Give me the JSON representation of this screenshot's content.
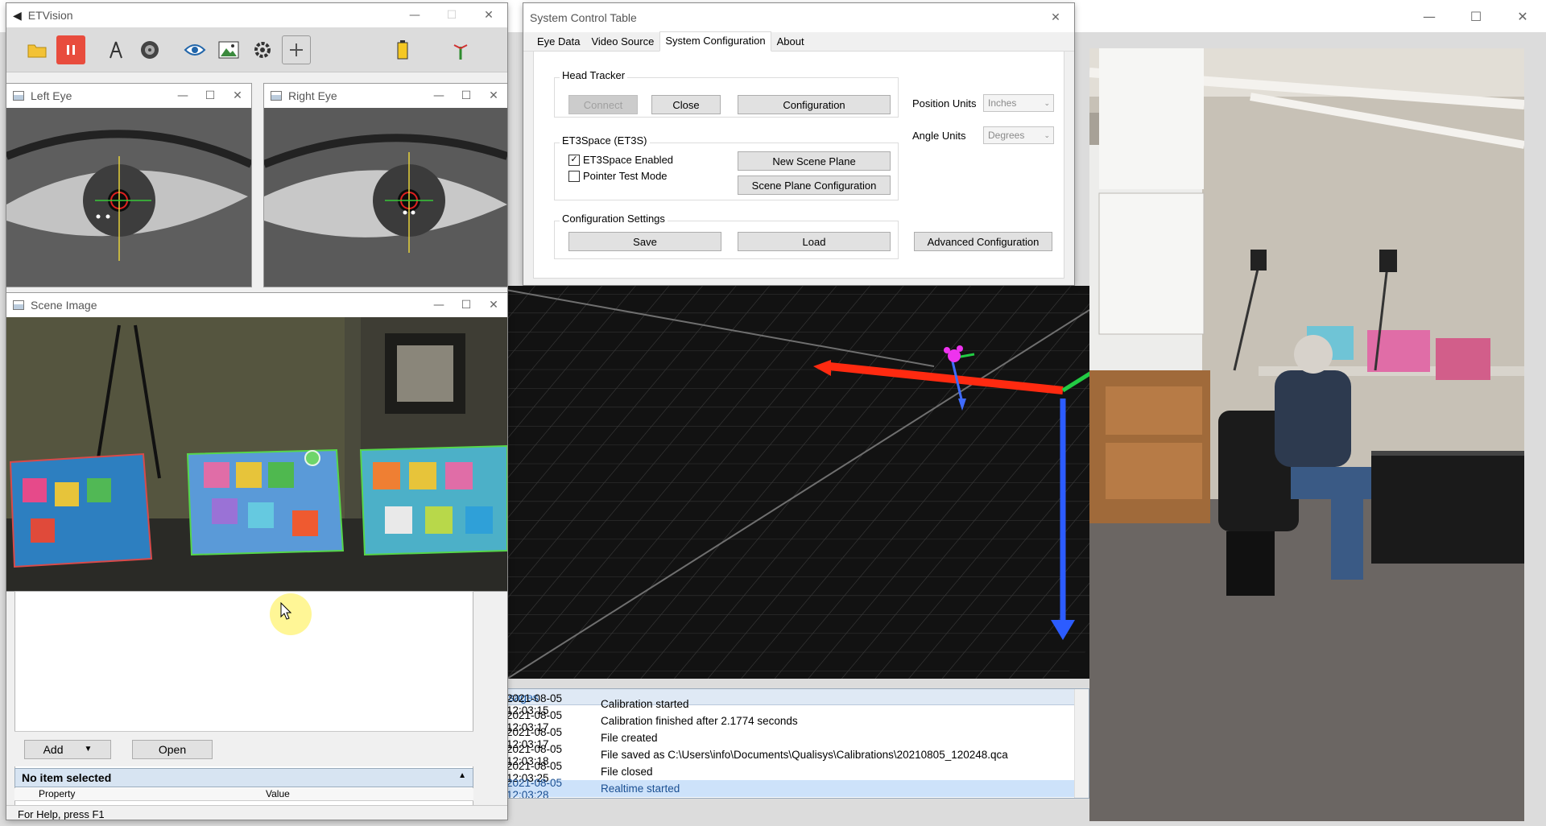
{
  "etvision": {
    "title": "ETVision",
    "toolbar": [
      {
        "icon": "folder-open-icon"
      },
      {
        "icon": "pause-icon"
      },
      {
        "icon": "compass-icon"
      },
      {
        "icon": "disc-icon"
      },
      {
        "icon": "eye-icon"
      },
      {
        "icon": "image-icon"
      },
      {
        "icon": "gear-icon"
      },
      {
        "icon": "plus-icon"
      },
      {
        "icon": "battery-icon"
      },
      {
        "icon": "antenna-icon"
      }
    ],
    "left_eye": {
      "title": "Left Eye"
    },
    "right_eye": {
      "title": "Right Eye"
    },
    "scene_image": {
      "title": "Scene Image"
    },
    "add_label": "Add",
    "open_label": "Open",
    "no_item_label": "No item selected",
    "property_label": "Property",
    "value_label": "Value",
    "status_text": "For Help, press F1"
  },
  "sct": {
    "title": "System Control Table",
    "tabs": [
      "Eye Data",
      "Video Source",
      "System Configuration",
      "About"
    ],
    "active_tab": 2,
    "head_tracker": {
      "label": "Head Tracker",
      "connect": "Connect",
      "close": "Close",
      "configuration": "Configuration"
    },
    "et3s": {
      "label": "ET3Space (ET3S)",
      "enabled_label": "ET3Space Enabled",
      "enabled": true,
      "pointer_label": "Pointer Test Mode",
      "pointer": false,
      "new_scene_plane": "New Scene Plane",
      "scene_plane_config": "Scene Plane Configuration"
    },
    "config_settings": {
      "label": "Configuration Settings",
      "save": "Save",
      "load": "Load",
      "advanced": "Advanced Configuration"
    },
    "position_units": {
      "label": "Position Units",
      "value": "Inches"
    },
    "angle_units": {
      "label": "Angle Units",
      "value": "Degrees"
    }
  },
  "messages": {
    "header": "Messages",
    "rows": [
      {
        "ts": "2021-08-05 12:03:15",
        "text": "Calibration started"
      },
      {
        "ts": "2021-08-05 12:03:17",
        "text": "Calibration finished after 2.1774 seconds"
      },
      {
        "ts": "2021-08-05 12:03:17",
        "text": "File created"
      },
      {
        "ts": "2021-08-05 12:03:18",
        "text": "File saved as C:\\Users\\info\\Documents\\Qualisys\\Calibrations\\20210805_120248.qca"
      },
      {
        "ts": "2021-08-05 12:03:25",
        "text": "File closed"
      },
      {
        "ts": "2021-08-05 12:03:28",
        "text": "Realtime started"
      }
    ]
  }
}
